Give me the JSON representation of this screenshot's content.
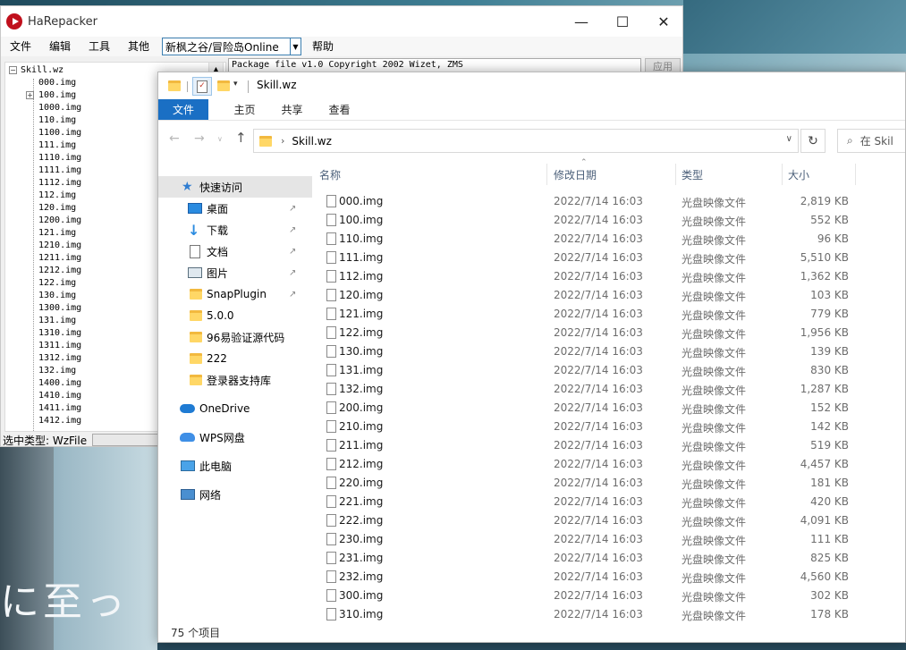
{
  "harepacker": {
    "title": "HaRepacker",
    "menu": [
      "文件",
      "编辑",
      "工具",
      "其他"
    ],
    "game_select": "新枫之谷/冒险岛Online",
    "help": "帮助",
    "textbox": "Package file v1.0 Copyright 2002 Wizet, ZMS",
    "apply": "应用",
    "status_label": "选中类型: WzFile",
    "tree_root": "Skill.wz",
    "tree_items": [
      "000.img",
      "100.img",
      "1000.img",
      "110.img",
      "1100.img",
      "111.img",
      "1110.img",
      "1111.img",
      "1112.img",
      "112.img",
      "120.img",
      "1200.img",
      "121.img",
      "1210.img",
      "1211.img",
      "1212.img",
      "122.img",
      "130.img",
      "1300.img",
      "131.img",
      "1310.img",
      "1311.img",
      "1312.img",
      "132.img",
      "1400.img",
      "1410.img",
      "1411.img",
      "1412.img"
    ]
  },
  "explorer": {
    "title": "Skill.wz",
    "ribbon": {
      "file": "文件",
      "tabs": [
        "主页",
        "共享",
        "查看"
      ]
    },
    "address": "Skill.wz",
    "search_placeholder": "在 Skil",
    "columns": {
      "name": "名称",
      "date": "修改日期",
      "type": "类型",
      "size": "大小"
    },
    "sidebar": {
      "quick_access": "快速访问",
      "pinned": [
        "桌面",
        "下载",
        "文档",
        "图片",
        "SnapPlugin"
      ],
      "folders": [
        "5.0.0",
        "96易验证源代码",
        "222",
        "登录器支持库"
      ],
      "onedrive": "OneDrive",
      "wps": "WPS网盘",
      "this_pc": "此电脑",
      "network": "网络"
    },
    "files": [
      {
        "name": "000.img",
        "date": "2022/7/14 16:03",
        "type": "光盘映像文件",
        "size": "2,819 KB"
      },
      {
        "name": "100.img",
        "date": "2022/7/14 16:03",
        "type": "光盘映像文件",
        "size": "552 KB"
      },
      {
        "name": "110.img",
        "date": "2022/7/14 16:03",
        "type": "光盘映像文件",
        "size": "96 KB"
      },
      {
        "name": "111.img",
        "date": "2022/7/14 16:03",
        "type": "光盘映像文件",
        "size": "5,510 KB"
      },
      {
        "name": "112.img",
        "date": "2022/7/14 16:03",
        "type": "光盘映像文件",
        "size": "1,362 KB"
      },
      {
        "name": "120.img",
        "date": "2022/7/14 16:03",
        "type": "光盘映像文件",
        "size": "103 KB"
      },
      {
        "name": "121.img",
        "date": "2022/7/14 16:03",
        "type": "光盘映像文件",
        "size": "779 KB"
      },
      {
        "name": "122.img",
        "date": "2022/7/14 16:03",
        "type": "光盘映像文件",
        "size": "1,956 KB"
      },
      {
        "name": "130.img",
        "date": "2022/7/14 16:03",
        "type": "光盘映像文件",
        "size": "139 KB"
      },
      {
        "name": "131.img",
        "date": "2022/7/14 16:03",
        "type": "光盘映像文件",
        "size": "830 KB"
      },
      {
        "name": "132.img",
        "date": "2022/7/14 16:03",
        "type": "光盘映像文件",
        "size": "1,287 KB"
      },
      {
        "name": "200.img",
        "date": "2022/7/14 16:03",
        "type": "光盘映像文件",
        "size": "152 KB"
      },
      {
        "name": "210.img",
        "date": "2022/7/14 16:03",
        "type": "光盘映像文件",
        "size": "142 KB"
      },
      {
        "name": "211.img",
        "date": "2022/7/14 16:03",
        "type": "光盘映像文件",
        "size": "519 KB"
      },
      {
        "name": "212.img",
        "date": "2022/7/14 16:03",
        "type": "光盘映像文件",
        "size": "4,457 KB"
      },
      {
        "name": "220.img",
        "date": "2022/7/14 16:03",
        "type": "光盘映像文件",
        "size": "181 KB"
      },
      {
        "name": "221.img",
        "date": "2022/7/14 16:03",
        "type": "光盘映像文件",
        "size": "420 KB"
      },
      {
        "name": "222.img",
        "date": "2022/7/14 16:03",
        "type": "光盘映像文件",
        "size": "4,091 KB"
      },
      {
        "name": "230.img",
        "date": "2022/7/14 16:03",
        "type": "光盘映像文件",
        "size": "111 KB"
      },
      {
        "name": "231.img",
        "date": "2022/7/14 16:03",
        "type": "光盘映像文件",
        "size": "825 KB"
      },
      {
        "name": "232.img",
        "date": "2022/7/14 16:03",
        "type": "光盘映像文件",
        "size": "4,560 KB"
      },
      {
        "name": "300.img",
        "date": "2022/7/14 16:03",
        "type": "光盘映像文件",
        "size": "302 KB"
      },
      {
        "name": "310.img",
        "date": "2022/7/14 16:03",
        "type": "光盘映像文件",
        "size": "178 KB"
      }
    ],
    "status": "75 个项目"
  },
  "wallpaper_text": "に至っ"
}
